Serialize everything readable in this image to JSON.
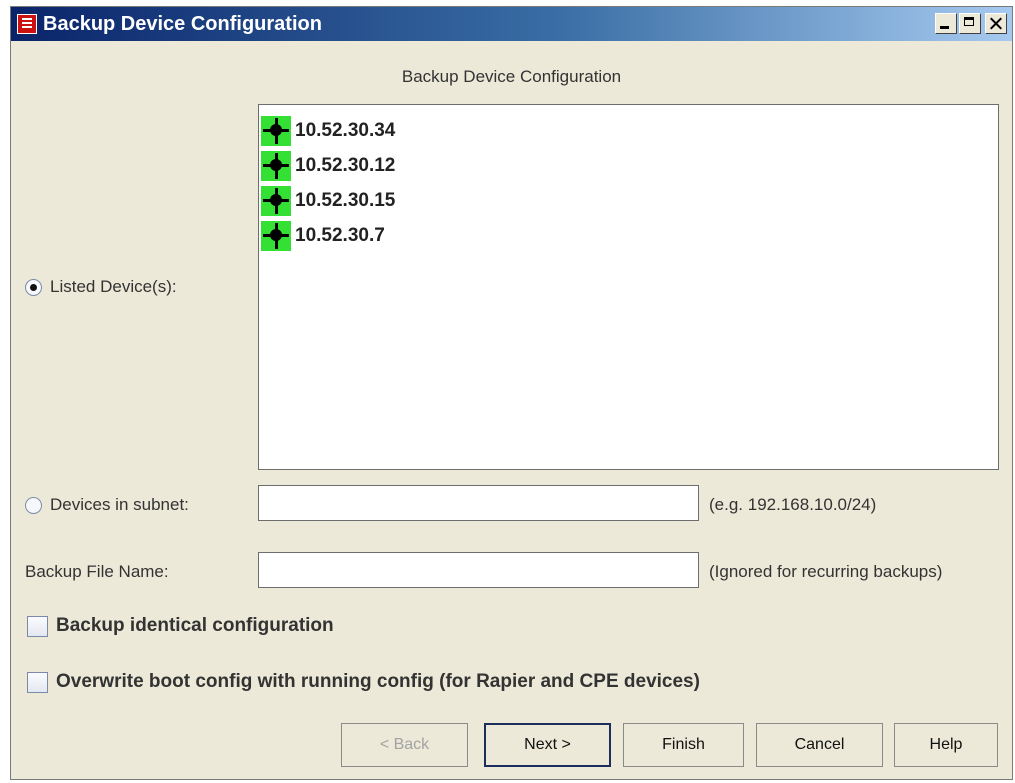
{
  "window": {
    "title": "Backup Device Configuration"
  },
  "heading": "Backup Device Configuration",
  "listed_devices": {
    "label": "Listed Device(s):",
    "selected": true,
    "devices": [
      "10.52.30.34",
      "10.52.30.12",
      "10.52.30.15",
      "10.52.30.7"
    ]
  },
  "subnet": {
    "label": "Devices in subnet:",
    "selected": false,
    "value": "",
    "hint": "(e.g. 192.168.10.0/24)"
  },
  "backup_file": {
    "label": "Backup File Name:",
    "value": "",
    "hint": "(Ignored for recurring backups)"
  },
  "options": {
    "identical_label": "Backup identical configuration",
    "identical_checked": false,
    "overwrite_label": "Overwrite boot config with running config (for Rapier and CPE devices)",
    "overwrite_checked": false
  },
  "buttons": {
    "back": "< Back",
    "next": "Next >",
    "finish": "Finish",
    "cancel": "Cancel",
    "help": "Help"
  },
  "colors": {
    "title_bar": "#0a246a",
    "device_icon": "#33e033",
    "dialog_bg": "#ece9d8"
  }
}
